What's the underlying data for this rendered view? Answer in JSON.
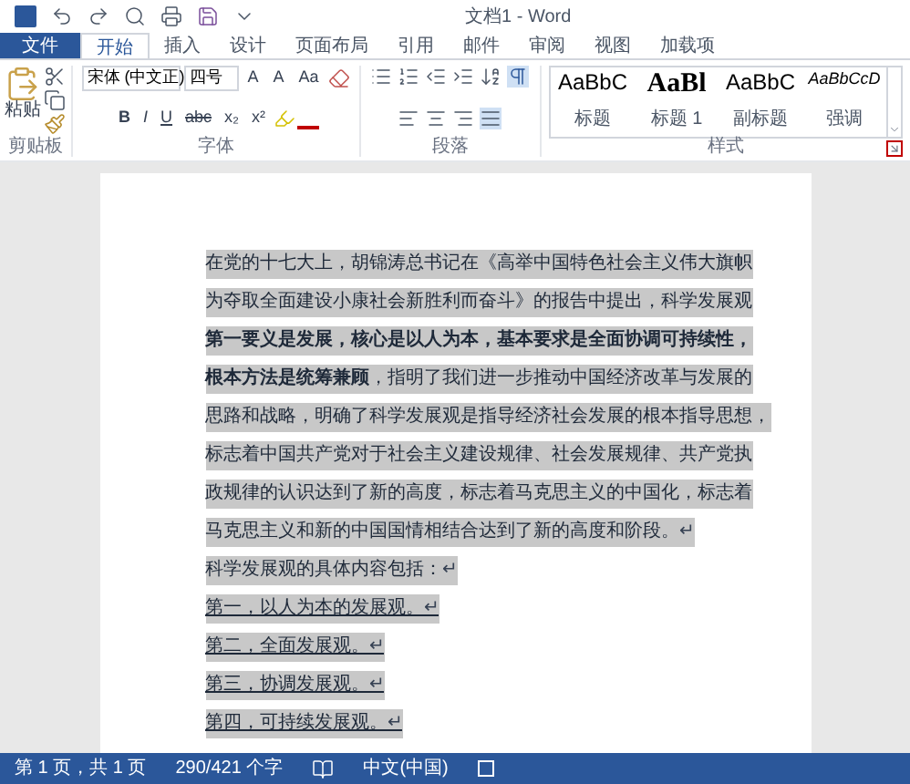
{
  "window": {
    "title": "文档1 - Word"
  },
  "tabs": [
    {
      "label": "文件",
      "kind": "file",
      "selected": false
    },
    {
      "label": "开始",
      "kind": "tab",
      "selected": true
    },
    {
      "label": "插入",
      "kind": "tab",
      "selected": false
    },
    {
      "label": "设计",
      "kind": "tab",
      "selected": false
    },
    {
      "label": "页面布局",
      "kind": "tab",
      "selected": false
    },
    {
      "label": "引用",
      "kind": "tab",
      "selected": false
    },
    {
      "label": "邮件",
      "kind": "tab",
      "selected": false
    },
    {
      "label": "审阅",
      "kind": "tab",
      "selected": false
    },
    {
      "label": "视图",
      "kind": "tab",
      "selected": false
    },
    {
      "label": "加载项",
      "kind": "tab",
      "selected": false
    }
  ],
  "ribbon": {
    "clipboard": {
      "paste": "粘贴",
      "label": "剪贴板"
    },
    "font": {
      "font_name": "宋体 (中文正)",
      "font_size": "四号",
      "grow": "A",
      "shrink": "A",
      "case": "Aa",
      "bold": "B",
      "italic": "I",
      "underline": "U",
      "strike": "abc",
      "subscript": "x₂",
      "superscript": "x²",
      "label": "字体"
    },
    "paragraph": {
      "label": "段落"
    },
    "styles": {
      "items": [
        {
          "preview": "AaBbC",
          "name": "标题",
          "kind": "plain"
        },
        {
          "preview": "AaBl",
          "name": "标题 1",
          "kind": "heading"
        },
        {
          "preview": "AaBbC",
          "name": "副标题",
          "kind": "plain"
        },
        {
          "preview": "AaBbCcD",
          "name": "强调",
          "kind": "emphasis"
        }
      ],
      "label": "样式"
    }
  },
  "document": {
    "lines": [
      {
        "text": "在党的十七大上，胡锦涛总书记在《高举中国特色社会主义伟大旗帜",
        "bold": false,
        "underline": false,
        "mark": false,
        "selected": true
      },
      {
        "text": "为夺取全面建设小康社会新胜利而奋斗》的报告中提出，科学发展观",
        "bold": false,
        "underline": false,
        "mark": false,
        "selected": true
      },
      {
        "text": "第一要义是发展，核心是以人为本，基本要求是全面协调可持续性，",
        "bold": true,
        "underline": false,
        "mark": false,
        "selected": true
      },
      {
        "text": "**根本方法是统筹兼顾**，指明了我们进一步推动中国经济改革与发展的",
        "bold": false,
        "underline": false,
        "mark": false,
        "selected": true
      },
      {
        "text": "思路和战略，明确了科学发展观是指导经济社会发展的根本指导思想，",
        "bold": false,
        "underline": false,
        "mark": false,
        "selected": true
      },
      {
        "text": "标志着中国共产党对于社会主义建设规律、社会发展规律、共产党执",
        "bold": false,
        "underline": false,
        "mark": false,
        "selected": true
      },
      {
        "text": "政规律的认识达到了新的高度，标志着马克思主义的中国化，标志着",
        "bold": false,
        "underline": false,
        "mark": false,
        "selected": true
      },
      {
        "text": "马克思主义和新的中国国情相结合达到了新的高度和阶段。",
        "bold": false,
        "underline": false,
        "mark": true,
        "selected": true
      },
      {
        "text": "科学发展观的具体内容包括：",
        "bold": false,
        "underline": false,
        "mark": true,
        "selected": true
      },
      {
        "text": "第一，以人为本的发展观。",
        "bold": false,
        "underline": true,
        "mark": true,
        "selected": true
      },
      {
        "text": "第二，全面发展观。",
        "bold": false,
        "underline": true,
        "mark": true,
        "selected": true
      },
      {
        "text": "第三，协调发展观。",
        "bold": false,
        "underline": true,
        "mark": true,
        "selected": true
      },
      {
        "text": "第四，可持续发展观。",
        "bold": false,
        "underline": true,
        "mark": true,
        "selected": true
      }
    ],
    "paragraph_mark": "↵"
  },
  "status_bar": {
    "page": "第 1 页，共 1 页",
    "words": "290/421 个字",
    "language": "中文(中国)"
  }
}
